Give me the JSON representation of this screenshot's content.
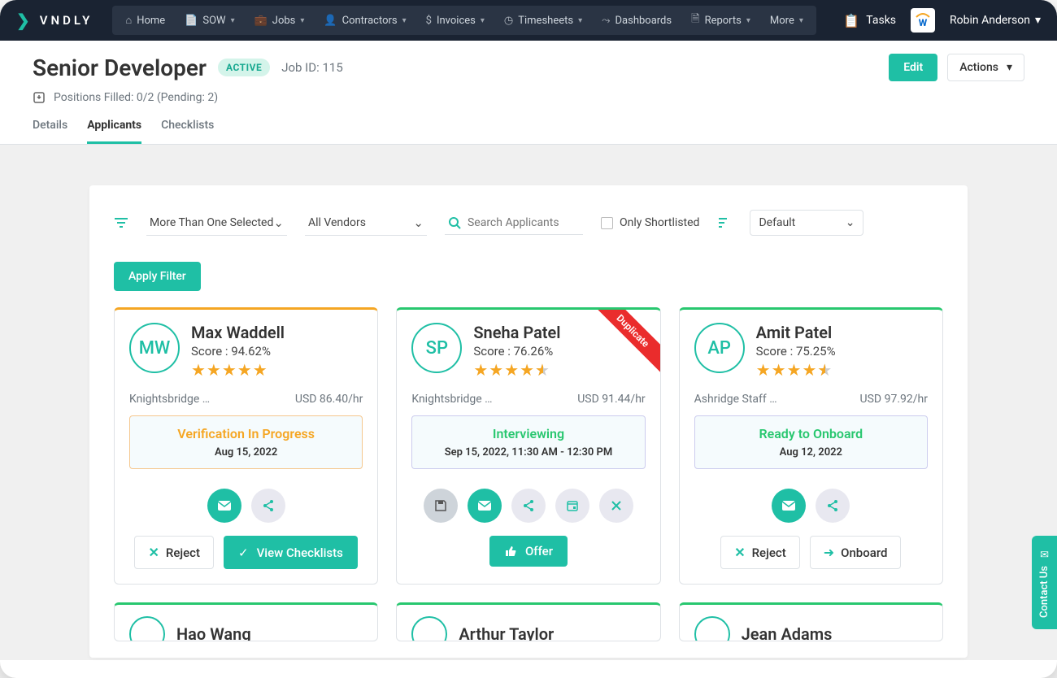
{
  "brand": "VNDLY",
  "nav": {
    "home": "Home",
    "sow": "SOW",
    "jobs": "Jobs",
    "contractors": "Contractors",
    "invoices": "Invoices",
    "timesheets": "Timesheets",
    "dashboards": "Dashboards",
    "reports": "Reports",
    "more": "More"
  },
  "tasks_label": "Tasks",
  "user_name": "Robin Anderson",
  "page": {
    "title": "Senior Developer",
    "status_badge": "ACTIVE",
    "job_id": "Job ID: 115",
    "positions": "Positions Filled: 0/2 (Pending: 2)",
    "edit": "Edit",
    "actions": "Actions"
  },
  "tabs": {
    "details": "Details",
    "applicants": "Applicants",
    "checklists": "Checklists"
  },
  "filters": {
    "selection": "More Than One Selected",
    "vendors": "All Vendors",
    "search_placeholder": "Search Applicants",
    "shortlisted": "Only Shortlisted",
    "sort": "Default",
    "apply": "Apply Filter"
  },
  "applicants": [
    {
      "initials": "MW",
      "name": "Max Waddell",
      "score": "Score : 94.62%",
      "stars": 5,
      "half": false,
      "vendor": "Knightsbridge …",
      "rate": "USD 86.40/hr",
      "status": "Verification In Progress",
      "status_color": "orange",
      "status_date": "Aug 15, 2022",
      "border": "orange",
      "ribbon": "",
      "reject": "Reject",
      "primary": "View Checklists",
      "primary_icon": "check"
    },
    {
      "initials": "SP",
      "name": "Sneha Patel",
      "score": "Score : 76.26%",
      "stars": 4,
      "half": true,
      "vendor": "Knightsbridge …",
      "rate": "USD 91.44/hr",
      "status": "Interviewing",
      "status_color": "green",
      "status_date": "Sep 15, 2022, 11:30 AM - 12:30 PM",
      "border": "green",
      "ribbon": "Duplicate",
      "reject": "",
      "primary": "Offer",
      "primary_icon": "thumb"
    },
    {
      "initials": "AP",
      "name": "Amit Patel",
      "score": "Score : 75.25%",
      "stars": 4,
      "half": true,
      "vendor": "Ashridge Staff …",
      "rate": "USD 97.92/hr",
      "status": "Ready to Onboard",
      "status_color": "green",
      "status_date": "Aug 12, 2022",
      "border": "green",
      "ribbon": "",
      "reject": "Reject",
      "primary": "Onboard",
      "primary_icon": "arrow"
    }
  ],
  "next_row": [
    {
      "name": "Hao Wang"
    },
    {
      "name": "Arthur Taylor"
    },
    {
      "name": "Jean Adams"
    }
  ],
  "contact": "Contact Us"
}
